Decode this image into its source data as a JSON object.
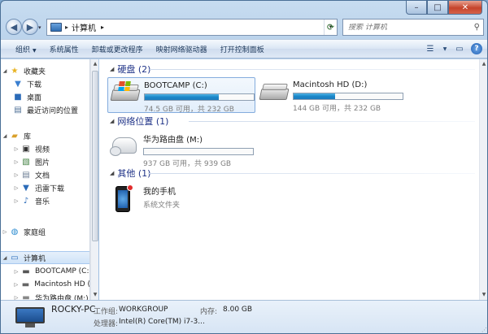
{
  "window": {
    "caption": {
      "minimize": "–",
      "maximize": "□",
      "close": "✕"
    }
  },
  "address": {
    "path": "计算机",
    "sep": "▸",
    "sep2": "▸",
    "back": "◀",
    "forward": "▶",
    "dropdown": "▾"
  },
  "search": {
    "placeholder": "搜索 计算机"
  },
  "toolbar": {
    "organize": "组织",
    "system_properties": "系统属性",
    "uninstall": "卸载或更改程序",
    "map_drive": "映射网络驱动器",
    "control_panel": "打开控制面板"
  },
  "nav": {
    "favorites": "收藏夹",
    "downloads": "下载",
    "desktop": "桌面",
    "recent": "最近访问的位置",
    "libraries": "库",
    "videos": "视频",
    "pictures": "图片",
    "documents": "文档",
    "xunlei": "迅雷下载",
    "music": "音乐",
    "homegroup": "家庭组",
    "computer": "计算机",
    "bootcamp": "BOOTCAMP (C:",
    "machd": "Macintosh HD (",
    "huawei": "华为路由盘 (M:)"
  },
  "groups": {
    "hdd": "硬盘 (2)",
    "network": "网络位置 (1)",
    "other": "其他 (1)"
  },
  "drives": [
    {
      "name": "BOOTCAMP (C:)",
      "free": "74.5 GB 可用，共 232 GB",
      "used_fraction": 0.68
    },
    {
      "name": "Macintosh HD (D:)",
      "free": "144 GB 可用，共 232 GB",
      "used_fraction": 0.38
    }
  ],
  "network_drive": {
    "name": "华为路由盘 (M:)",
    "free": "937 GB 可用，共 939 GB",
    "used_fraction": 0.0
  },
  "other_item": {
    "name": "我的手机",
    "type": "系统文件夹"
  },
  "details": {
    "computer_name": "ROCKY-PC",
    "workgroup_label": "工作组:",
    "workgroup_value": "WORKGROUP",
    "memory_label": "内存:",
    "memory_value": "8.00 GB",
    "cpu_label": "处理器:",
    "cpu_value": "Intel(R) Core(TM) i7-3..."
  }
}
